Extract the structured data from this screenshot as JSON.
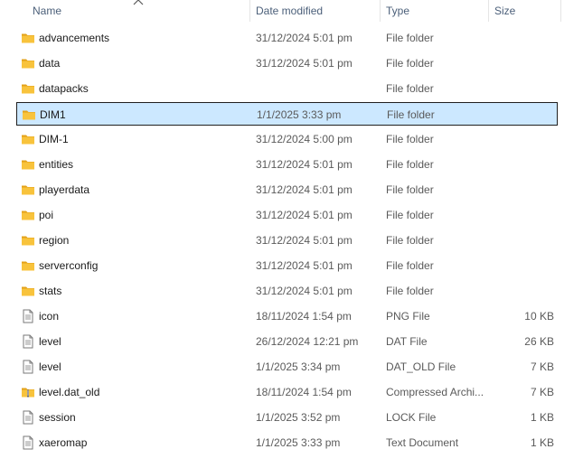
{
  "columns": {
    "name": "Name",
    "date_modified": "Date modified",
    "type": "Type",
    "size": "Size"
  },
  "rows": [
    {
      "name": "advancements",
      "date": "31/12/2024 5:01 pm",
      "type": "File folder",
      "size": "",
      "icon": "folder-icon"
    },
    {
      "name": "data",
      "date": "31/12/2024 5:01 pm",
      "type": "File folder",
      "size": "",
      "icon": "folder-icon"
    },
    {
      "name": "datapacks",
      "date": "",
      "type": "File folder",
      "size": "",
      "icon": "folder-icon"
    },
    {
      "name": "DIM1",
      "date": "1/1/2025 3:33 pm",
      "type": "File folder",
      "size": "",
      "icon": "folder-icon",
      "selected": true
    },
    {
      "name": "DIM-1",
      "date": "31/12/2024 5:00 pm",
      "type": "File folder",
      "size": "",
      "icon": "folder-icon"
    },
    {
      "name": "entities",
      "date": "31/12/2024 5:01 pm",
      "type": "File folder",
      "size": "",
      "icon": "folder-icon"
    },
    {
      "name": "playerdata",
      "date": "31/12/2024 5:01 pm",
      "type": "File folder",
      "size": "",
      "icon": "folder-icon"
    },
    {
      "name": "poi",
      "date": "31/12/2024 5:01 pm",
      "type": "File folder",
      "size": "",
      "icon": "folder-icon"
    },
    {
      "name": "region",
      "date": "31/12/2024 5:01 pm",
      "type": "File folder",
      "size": "",
      "icon": "folder-icon"
    },
    {
      "name": "serverconfig",
      "date": "31/12/2024 5:01 pm",
      "type": "File folder",
      "size": "",
      "icon": "folder-icon"
    },
    {
      "name": "stats",
      "date": "31/12/2024 5:01 pm",
      "type": "File folder",
      "size": "",
      "icon": "folder-icon"
    },
    {
      "name": "icon",
      "date": "18/11/2024 1:54 pm",
      "type": "PNG File",
      "size": "10 KB",
      "icon": "file-icon"
    },
    {
      "name": "level",
      "date": "26/12/2024 12:21 pm",
      "type": "DAT File",
      "size": "26 KB",
      "icon": "file-icon"
    },
    {
      "name": "level",
      "date": "1/1/2025 3:34 pm",
      "type": "DAT_OLD File",
      "size": "7 KB",
      "icon": "file-icon"
    },
    {
      "name": "level.dat_old",
      "date": "18/11/2024 1:54 pm",
      "type": "Compressed Archi...",
      "size": "7 KB",
      "icon": "zip-folder-icon"
    },
    {
      "name": "session",
      "date": "1/1/2025 3:52 pm",
      "type": "LOCK File",
      "size": "1 KB",
      "icon": "file-icon"
    },
    {
      "name": "xaeromap",
      "date": "1/1/2025 3:33 pm",
      "type": "Text Document",
      "size": "1 KB",
      "icon": "file-icon"
    }
  ],
  "colors": {
    "selection_bg": "#cce8ff",
    "header_text": "#4c607a",
    "folder": "#f8c33c"
  }
}
